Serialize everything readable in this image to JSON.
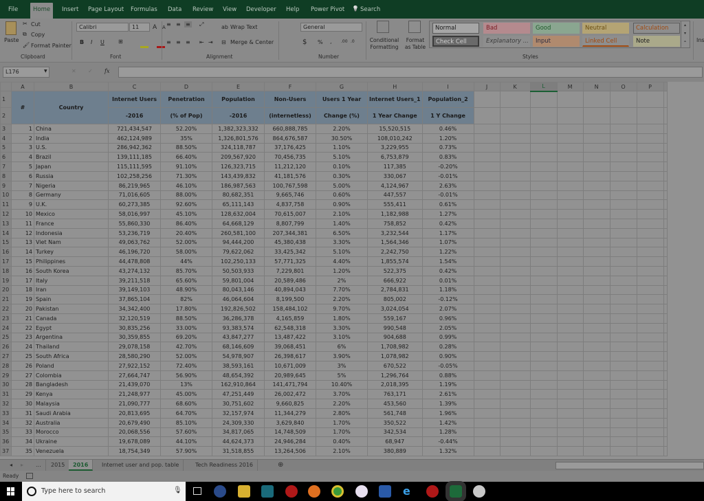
{
  "ribbon_tabs": [
    "File",
    "Home",
    "Insert",
    "Page Layout",
    "Formulas",
    "Data",
    "Review",
    "View",
    "Developer",
    "Help",
    "Power Pivot",
    "Search"
  ],
  "active_tab": "Home",
  "clipboard": {
    "paste": "Paste",
    "cut": "Cut",
    "copy": "Copy",
    "format_painter": "Format Painter",
    "label": "Clipboard"
  },
  "font": {
    "name": "Calibri",
    "size": "11",
    "label": "Font",
    "bold": "B",
    "italic": "I",
    "underline": "U",
    "grow": "A",
    "shrink": "A"
  },
  "alignment": {
    "wrap_text": "Wrap Text",
    "merge_center": "Merge & Center",
    "label": "Alignment"
  },
  "number": {
    "format": "General",
    "currency": "$",
    "percent": "%",
    "comma": ",",
    "label": "Number"
  },
  "styles": {
    "conditional_formatting": "Conditional Formatting",
    "format_as_table": "Format as Table",
    "label": "Styles",
    "cells": [
      {
        "label": "Normal",
        "bg": "#a6a6a6",
        "fg": "#1a1a1a"
      },
      {
        "label": "Bad",
        "bg": "#b48a8e",
        "fg": "#7a1a22"
      },
      {
        "label": "Good",
        "bg": "#8aa690",
        "fg": "#1e5a2a"
      },
      {
        "label": "Neutral",
        "bg": "#b4a474",
        "fg": "#6a4e10"
      },
      {
        "label": "Calculation",
        "bg": "#8e8e8e",
        "fg": "#a04a10"
      },
      {
        "label": "Check Cell",
        "bg": "#6a6a6a",
        "fg": "#cfcfcf"
      },
      {
        "label": "Explanatory ...",
        "bg": "#8e8e8e",
        "fg": "#3c3c3c"
      },
      {
        "label": "Input",
        "bg": "#b08a6e",
        "fg": "#2a2a40"
      },
      {
        "label": "Linked Cell",
        "bg": "#8e8e8e",
        "fg": "#a04a10"
      },
      {
        "label": "Note",
        "bg": "#aaa98a",
        "fg": "#1a1a1a"
      }
    ]
  },
  "insert_label": "Ins",
  "formula_bar": {
    "name_box": "L176",
    "fx": "fx",
    "formula": ""
  },
  "columns": [
    "A",
    "B",
    "C",
    "D",
    "E",
    "F",
    "G",
    "H",
    "I",
    "J",
    "K",
    "L",
    "M",
    "N",
    "O",
    "P"
  ],
  "selected_column": "L",
  "headers_row1": [
    "#",
    "Country",
    "Internet Users",
    "Penetration",
    "Population",
    "Non-Users",
    "Users 1 Year",
    "Internet Users_1",
    "Population_2"
  ],
  "headers_row2": [
    "",
    "",
    "-2016",
    "(% of Pop)",
    "-2016",
    "(internetless)",
    "Change (%)",
    "1 Year Change",
    "1 Y Change"
  ],
  "rows": [
    [
      1,
      "China",
      "721,434,547",
      "52.20%",
      "1,382,323,332",
      "660,888,785",
      "2.20%",
      "15,520,515",
      "0.46%"
    ],
    [
      2,
      "India",
      "462,124,989",
      "35%",
      "1,326,801,576",
      "864,676,587",
      "30.50%",
      "108,010,242",
      "1.20%"
    ],
    [
      3,
      "U.S.",
      "286,942,362",
      "88.50%",
      "324,118,787",
      "37,176,425",
      "1.10%",
      "3,229,955",
      "0.73%"
    ],
    [
      4,
      "Brazil",
      "139,111,185",
      "66.40%",
      "209,567,920",
      "70,456,735",
      "5.10%",
      "6,753,879",
      "0.83%"
    ],
    [
      5,
      "Japan",
      "115,111,595",
      "91.10%",
      "126,323,715",
      "11,212,120",
      "0.10%",
      "117,385",
      "-0.20%"
    ],
    [
      6,
      "Russia",
      "102,258,256",
      "71.30%",
      "143,439,832",
      "41,181,576",
      "0.30%",
      "330,067",
      "-0.01%"
    ],
    [
      7,
      "Nigeria",
      "86,219,965",
      "46.10%",
      "186,987,563",
      "100,767,598",
      "5.00%",
      "4,124,967",
      "2.63%"
    ],
    [
      8,
      "Germany",
      "71,016,605",
      "88.00%",
      "80,682,351",
      "9,665,746",
      "0.60%",
      "447,557",
      "-0.01%"
    ],
    [
      9,
      "U.K.",
      "60,273,385",
      "92.60%",
      "65,111,143",
      "4,837,758",
      "0.90%",
      "555,411",
      "0.61%"
    ],
    [
      10,
      "Mexico",
      "58,016,997",
      "45.10%",
      "128,632,004",
      "70,615,007",
      "2.10%",
      "1,182,988",
      "1.27%"
    ],
    [
      11,
      "France",
      "55,860,330",
      "86.40%",
      "64,668,129",
      "8,807,799",
      "1.40%",
      "758,852",
      "0.42%"
    ],
    [
      12,
      "Indonesia",
      "53,236,719",
      "20.40%",
      "260,581,100",
      "207,344,381",
      "6.50%",
      "3,232,544",
      "1.17%"
    ],
    [
      13,
      "Viet Nam",
      "49,063,762",
      "52.00%",
      "94,444,200",
      "45,380,438",
      "3.30%",
      "1,564,346",
      "1.07%"
    ],
    [
      14,
      "Turkey",
      "46,196,720",
      "58.00%",
      "79,622,062",
      "33,425,342",
      "5.10%",
      "2,242,750",
      "1.22%"
    ],
    [
      15,
      "Philippines",
      "44,478,808",
      "44%",
      "102,250,133",
      "57,771,325",
      "4.40%",
      "1,855,574",
      "1.54%"
    ],
    [
      16,
      "South Korea",
      "43,274,132",
      "85.70%",
      "50,503,933",
      "7,229,801",
      "1.20%",
      "522,375",
      "0.42%"
    ],
    [
      17,
      "Italy",
      "39,211,518",
      "65.60%",
      "59,801,004",
      "20,589,486",
      "2%",
      "666,922",
      "0.01%"
    ],
    [
      18,
      "Iran",
      "39,149,103",
      "48.90%",
      "80,043,146",
      "40,894,043",
      "7.70%",
      "2,784,831",
      "1.18%"
    ],
    [
      19,
      "Spain",
      "37,865,104",
      "82%",
      "46,064,604",
      "8,199,500",
      "2.20%",
      "805,002",
      "-0.12%"
    ],
    [
      20,
      "Pakistan",
      "34,342,400",
      "17.80%",
      "192,826,502",
      "158,484,102",
      "9.70%",
      "3,024,054",
      "2.07%"
    ],
    [
      21,
      "Canada",
      "32,120,519",
      "88.50%",
      "36,286,378",
      "4,165,859",
      "1.80%",
      "559,167",
      "0.96%"
    ],
    [
      22,
      "Egypt",
      "30,835,256",
      "33.00%",
      "93,383,574",
      "62,548,318",
      "3.30%",
      "990,548",
      "2.05%"
    ],
    [
      23,
      "Argentina",
      "30,359,855",
      "69.20%",
      "43,847,277",
      "13,487,422",
      "3.10%",
      "904,688",
      "0.99%"
    ],
    [
      24,
      "Thailand",
      "29,078,158",
      "42.70%",
      "68,146,609",
      "39,068,451",
      "6%",
      "1,708,982",
      "0.28%"
    ],
    [
      25,
      "South Africa",
      "28,580,290",
      "52.00%",
      "54,978,907",
      "26,398,617",
      "3.90%",
      "1,078,982",
      "0.90%"
    ],
    [
      26,
      "Poland",
      "27,922,152",
      "72.40%",
      "38,593,161",
      "10,671,009",
      "3%",
      "670,522",
      "-0.05%"
    ],
    [
      27,
      "Colombia",
      "27,664,747",
      "56.90%",
      "48,654,392",
      "20,989,645",
      "5%",
      "1,296,764",
      "0.88%"
    ],
    [
      28,
      "Bangladesh",
      "21,439,070",
      "13%",
      "162,910,864",
      "141,471,794",
      "10.40%",
      "2,018,395",
      "1.19%"
    ],
    [
      29,
      "Kenya",
      "21,248,977",
      "45.00%",
      "47,251,449",
      "26,002,472",
      "3.70%",
      "763,171",
      "2.61%"
    ],
    [
      30,
      "Malaysia",
      "21,090,777",
      "68.60%",
      "30,751,602",
      "9,660,825",
      "2.20%",
      "453,560",
      "1.39%"
    ],
    [
      31,
      "Saudi Arabia",
      "20,813,695",
      "64.70%",
      "32,157,974",
      "11,344,279",
      "2.80%",
      "561,748",
      "1.96%"
    ],
    [
      32,
      "Australia",
      "20,679,490",
      "85.10%",
      "24,309,330",
      "3,629,840",
      "1.70%",
      "350,522",
      "1.42%"
    ],
    [
      33,
      "Morocco",
      "20,068,556",
      "57.60%",
      "34,817,065",
      "14,748,509",
      "1.70%",
      "342,534",
      "1.28%"
    ],
    [
      34,
      "Ukraine",
      "19,678,089",
      "44.10%",
      "44,624,373",
      "24,946,284",
      "0.40%",
      "68,947",
      "-0.44%"
    ],
    [
      35,
      "Venezuela",
      "18,754,349",
      "57.90%",
      "31,518,855",
      "13,264,506",
      "2.10%",
      "380,889",
      "1.32%"
    ]
  ],
  "sheet_tabs": [
    "...",
    "2015",
    "2016",
    "Internet user and pop. table",
    "Tech Readiness 2016"
  ],
  "active_sheet": "2016",
  "status": "Ready",
  "taskbar": {
    "search_placeholder": "Type here to search"
  }
}
